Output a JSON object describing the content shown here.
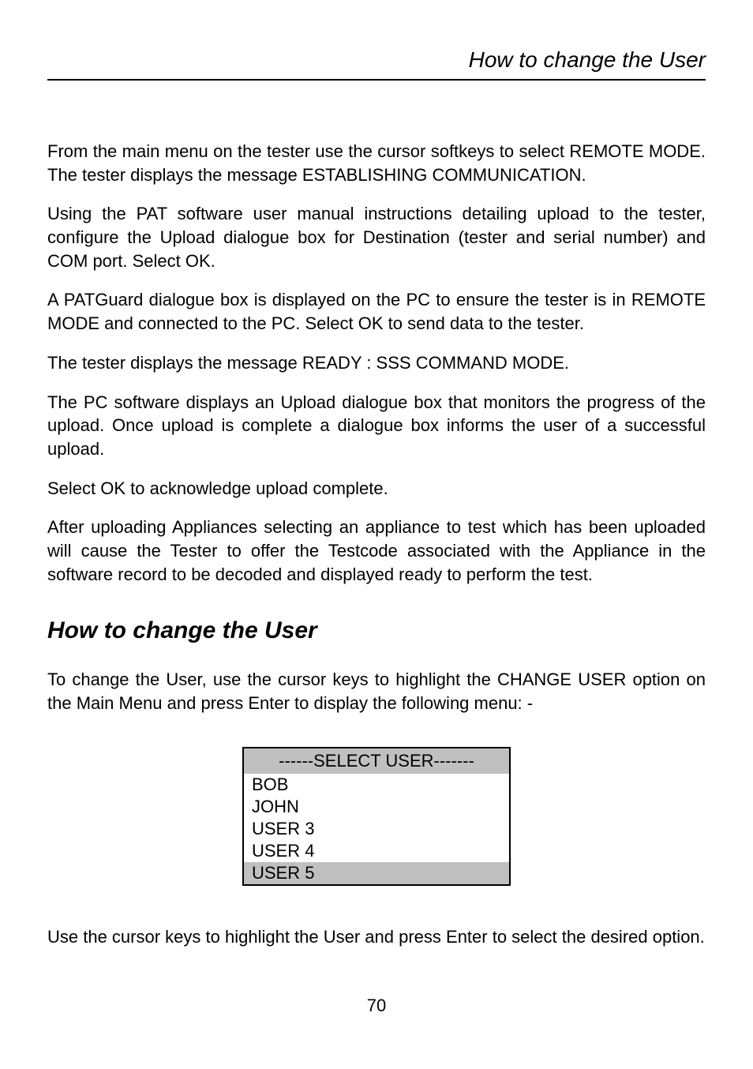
{
  "header": {
    "title": "How to change the User"
  },
  "paragraphs": {
    "p1": "From the main menu on the tester use the cursor softkeys to select REMOTE MODE. The tester displays the message ESTABLISHING COMMUNICATION.",
    "p2": "Using the PAT software user manual instructions detailing upload to the tester, configure the Upload dialogue box for Destination (tester and serial number) and COM port. Select OK.",
    "p3": "A PATGuard dialogue box is displayed on the PC to ensure the tester is in REMOTE MODE and connected to the PC. Select OK to send data to the tester.",
    "p4": "The tester displays the message READY : SSS COMMAND MODE.",
    "p5": "The PC software displays an Upload dialogue box that monitors the progress of the upload. Once upload is complete a dialogue box informs the user of a successful upload.",
    "p6": "Select OK to acknowledge upload complete.",
    "p7": "After uploading Appliances selecting an appliance to test which has been uploaded will cause the Tester to offer the Testcode associated with the Appliance in the software record to be decoded and displayed ready to perform the test."
  },
  "section": {
    "heading": "How to change the User",
    "intro": "To change the User, use the cursor keys to highlight the CHANGE USER option on the Main Menu and press Enter to display the following menu: -",
    "outro": "Use the cursor keys to highlight the User and press Enter to select the desired option."
  },
  "menu": {
    "title": "------SELECT USER-------",
    "items": {
      "i0": "BOB",
      "i1": "JOHN",
      "i2": "USER 3",
      "i3": "USER 4",
      "i4": "USER 5"
    }
  },
  "page": {
    "number": "70"
  }
}
